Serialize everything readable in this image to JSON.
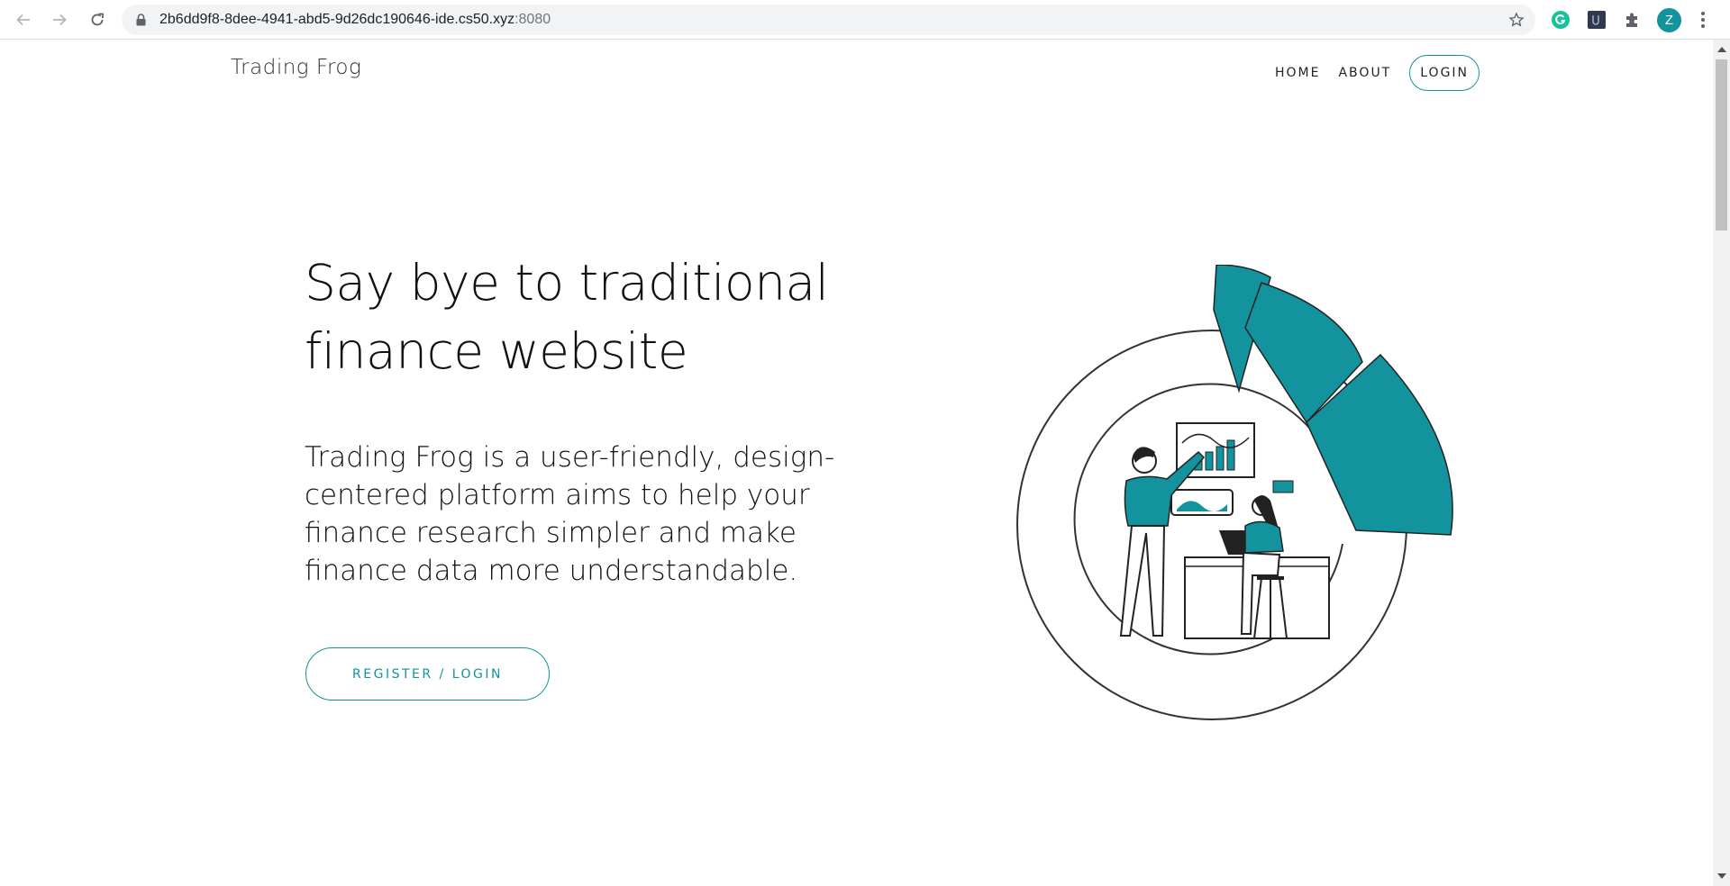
{
  "browser": {
    "url_host": "2b6dd9f8-8dee-4941-abd5-9d26dc190646-ide.cs50.xyz",
    "url_port": ":8080",
    "profile_initial": "Z",
    "accent_color": "#12939d",
    "icons": [
      "back-arrow-icon",
      "forward-arrow-icon",
      "reload-icon",
      "lock-icon",
      "star-icon",
      "grammarly-icon",
      "extension-icon",
      "puzzle-icon",
      "kebab-menu-icon"
    ]
  },
  "header": {
    "brand": "Trading Frog",
    "nav": {
      "home": "HOME",
      "about": "ABOUT",
      "login": "LOGIN"
    }
  },
  "hero": {
    "title_line1": "Say bye to traditional",
    "title_line2": "finance website",
    "description": "Trading Frog is a user-friendly, design-centered platform aims to help your finance research simpler and make finance data more understandable.",
    "cta_label": "REGISTER / LOGIN"
  },
  "theme": {
    "accent": "#12939d",
    "text": "#111111"
  }
}
